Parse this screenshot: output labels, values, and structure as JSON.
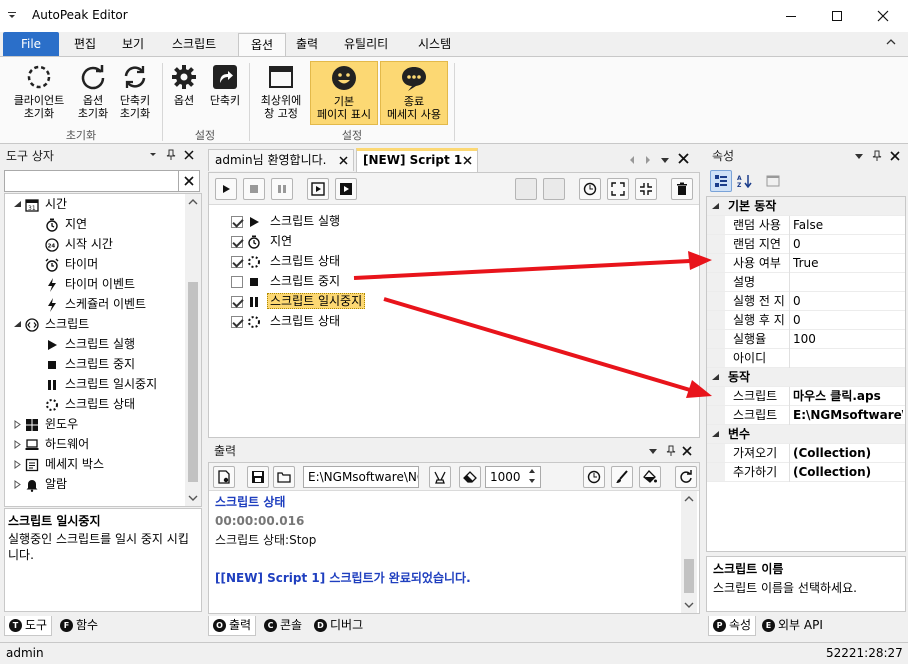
{
  "window": {
    "title": "AutoPeak Editor",
    "min_icon": "minimize-icon",
    "max_icon": "maximize-icon",
    "close_icon": "close-icon"
  },
  "ribbon_tabs": [
    "File",
    "편집",
    "보기",
    "스크립트",
    "옵션",
    "출력",
    "유틸리티",
    "시스템"
  ],
  "ribbon": {
    "groups": [
      {
        "label": "초기화",
        "buttons": [
          {
            "line1": "클라이언트",
            "line2": "초기화"
          },
          {
            "line1": "옵션",
            "line2": "초기화"
          },
          {
            "line1": "단축키",
            "line2": "초기화"
          }
        ]
      },
      {
        "label": "설정",
        "buttons": [
          {
            "line1": "옵션",
            "line2": ""
          },
          {
            "line1": "단축키",
            "line2": ""
          }
        ]
      },
      {
        "label": "설정",
        "buttons": [
          {
            "line1": "최상위에",
            "line2": "창 고정"
          },
          {
            "line1": "기본",
            "line2": "페이지 표시"
          },
          {
            "line1": "종료",
            "line2": "메세지 사용"
          }
        ]
      }
    ]
  },
  "toolbox": {
    "title": "도구 상자",
    "search_value": "",
    "tree": [
      {
        "label": "시간",
        "level": 1,
        "expander": "minus",
        "icon": "calendar-icon"
      },
      {
        "label": "지연",
        "level": 2,
        "icon": "stopwatch-icon"
      },
      {
        "label": "시작 시간",
        "level": 2,
        "icon": "clock-24-icon"
      },
      {
        "label": "타이머",
        "level": 2,
        "icon": "alarm-icon"
      },
      {
        "label": "타이머 이벤트",
        "level": 2,
        "icon": "lightning-icon"
      },
      {
        "label": "스케쥴러 이벤트",
        "level": 2,
        "icon": "lightning-icon"
      },
      {
        "label": "스크립트",
        "level": 1,
        "expander": "minus",
        "icon": "code-icon"
      },
      {
        "label": "스크립트 실행",
        "level": 2,
        "icon": "play-icon"
      },
      {
        "label": "스크립트 중지",
        "level": 2,
        "icon": "stop-icon"
      },
      {
        "label": "스크립트 일시중지",
        "level": 2,
        "icon": "pause-icon"
      },
      {
        "label": "스크립트 상태",
        "level": 2,
        "icon": "status-spinner-icon"
      },
      {
        "label": "윈도우",
        "level": 1,
        "expander": "plus",
        "icon": "windows-icon"
      },
      {
        "label": "하드웨어",
        "level": 1,
        "expander": "plus",
        "icon": "laptop-icon"
      },
      {
        "label": "메세지 박스",
        "level": 1,
        "expander": "plus",
        "icon": "message-icon"
      },
      {
        "label": "알람",
        "level": 1,
        "expander": "plus",
        "icon": "bell-icon"
      }
    ],
    "desc_title": "스크립트 일시중지",
    "desc_text": "실행중인 스크립트를 일시 중지 시킵니다.",
    "tabs": [
      {
        "letter": "T",
        "label": "도구"
      },
      {
        "letter": "F",
        "label": "함수"
      }
    ]
  },
  "editor": {
    "tabs": [
      {
        "label": "admin님 환영합니다."
      },
      {
        "label": "[NEW] Script 1"
      }
    ],
    "script_items": [
      {
        "label": "스크립트 실행",
        "checked": true,
        "icon": "play-icon"
      },
      {
        "label": "지연",
        "checked": true,
        "icon": "stopwatch-icon"
      },
      {
        "label": "스크립트 상태",
        "checked": true,
        "icon": "status-spinner-icon"
      },
      {
        "label": "스크립트 중지",
        "checked": false,
        "icon": "stop-icon"
      },
      {
        "label": "스크립트 일시중지",
        "checked": true,
        "icon": "pause-icon"
      },
      {
        "label": "스크립트 상태",
        "checked": true,
        "icon": "status-spinner-icon"
      }
    ]
  },
  "output": {
    "title": "출력",
    "path_value": "E:\\NGMsoftware\\NG",
    "count_value": "1000",
    "lines": [
      {
        "text": "스크립트 상태",
        "style": "blue-bold"
      },
      {
        "text": "00:00:00.016",
        "style": "gray-bold"
      },
      {
        "text": "스크립트 상태:Stop",
        "style": "normal"
      },
      {
        "text": "",
        "style": "normal"
      },
      {
        "text": "[[NEW] Script 1] 스크립트가 완료되었습니다.",
        "style": "blue-bold"
      }
    ],
    "tabs": [
      {
        "letter": "O",
        "label": "출력"
      },
      {
        "letter": "C",
        "label": "콘솔"
      },
      {
        "letter": "D",
        "label": "디버그"
      }
    ]
  },
  "properties": {
    "title": "속성",
    "sections": [
      {
        "name": "기본 동작",
        "rows": [
          {
            "key": "랜덤 사용",
            "value": "False",
            "bold": false
          },
          {
            "key": "랜덤 지연",
            "value": "0",
            "bold": false
          },
          {
            "key": "사용 여부",
            "value": "True",
            "bold": false
          },
          {
            "key": "설명",
            "value": "",
            "bold": false
          },
          {
            "key": "실행 전 지",
            "value": "0",
            "bold": false
          },
          {
            "key": "실행 후 지",
            "value": "0",
            "bold": false
          },
          {
            "key": "실행율",
            "value": "100",
            "bold": false
          },
          {
            "key": "아이디",
            "value": "",
            "bold": false
          }
        ]
      },
      {
        "name": "동작",
        "rows": [
          {
            "key": "스크립트",
            "value": "마우스 클릭.aps",
            "bold": true
          },
          {
            "key": "스크립트",
            "value": "E:\\NGMsoftware\\I",
            "bold": true
          }
        ]
      },
      {
        "name": "변수",
        "rows": [
          {
            "key": "가져오기",
            "value": "(Collection)",
            "bold": true
          },
          {
            "key": "추가하기",
            "value": "(Collection)",
            "bold": true
          }
        ]
      }
    ],
    "desc_title": "스크립트 이름",
    "desc_text": "스크립트 이름을 선택하세요.",
    "tabs": [
      {
        "letter": "P",
        "label": "속성"
      },
      {
        "letter": "E",
        "label": "외부 API"
      }
    ]
  },
  "status_bar": {
    "user": "admin",
    "time": "52221:28:27"
  },
  "colors": {
    "file_tab": "#2b6fc9",
    "highlight": "#fcd873",
    "arrow": "#e8141b",
    "output_blue": "#1f3fbf"
  }
}
